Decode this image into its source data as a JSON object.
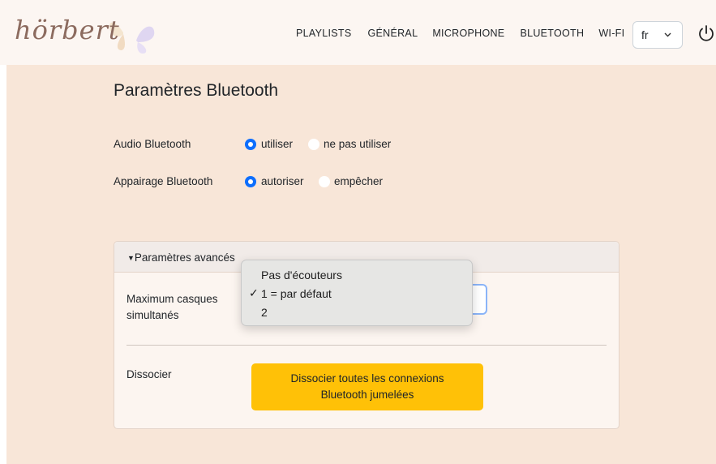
{
  "brand": {
    "logo_text": "hörbert"
  },
  "nav": {
    "items": [
      "PLAYLISTS",
      "GÉNÉRAL",
      "MICROPHONE",
      "BLUETOOTH",
      "WI-FI"
    ],
    "language": "fr"
  },
  "page": {
    "title": "Paramètres Bluetooth",
    "audio": {
      "label": "Audio Bluetooth",
      "options": [
        "utiliser",
        "ne pas utiliser"
      ],
      "selected": "utiliser"
    },
    "pairing": {
      "label": "Appairage Bluetooth",
      "options": [
        "autoriser",
        "empêcher"
      ],
      "selected": "autoriser"
    }
  },
  "advanced": {
    "header": "Paramètres avancés",
    "max_headsets_label": "Maximum casques simultanés",
    "dropdown_options": [
      "Pas d'écouteurs",
      "1 = par défaut",
      "2"
    ],
    "dropdown_selected": "1 = par défaut",
    "checkmark": "✓",
    "unpair_label": "Dissocier",
    "unpair_button": "Dissocier toutes les connexions Bluetooth jumelées"
  },
  "colors": {
    "accent": "#0d6efd",
    "page_bg": "#f8e6d8",
    "button_warning": "#ffc107"
  }
}
